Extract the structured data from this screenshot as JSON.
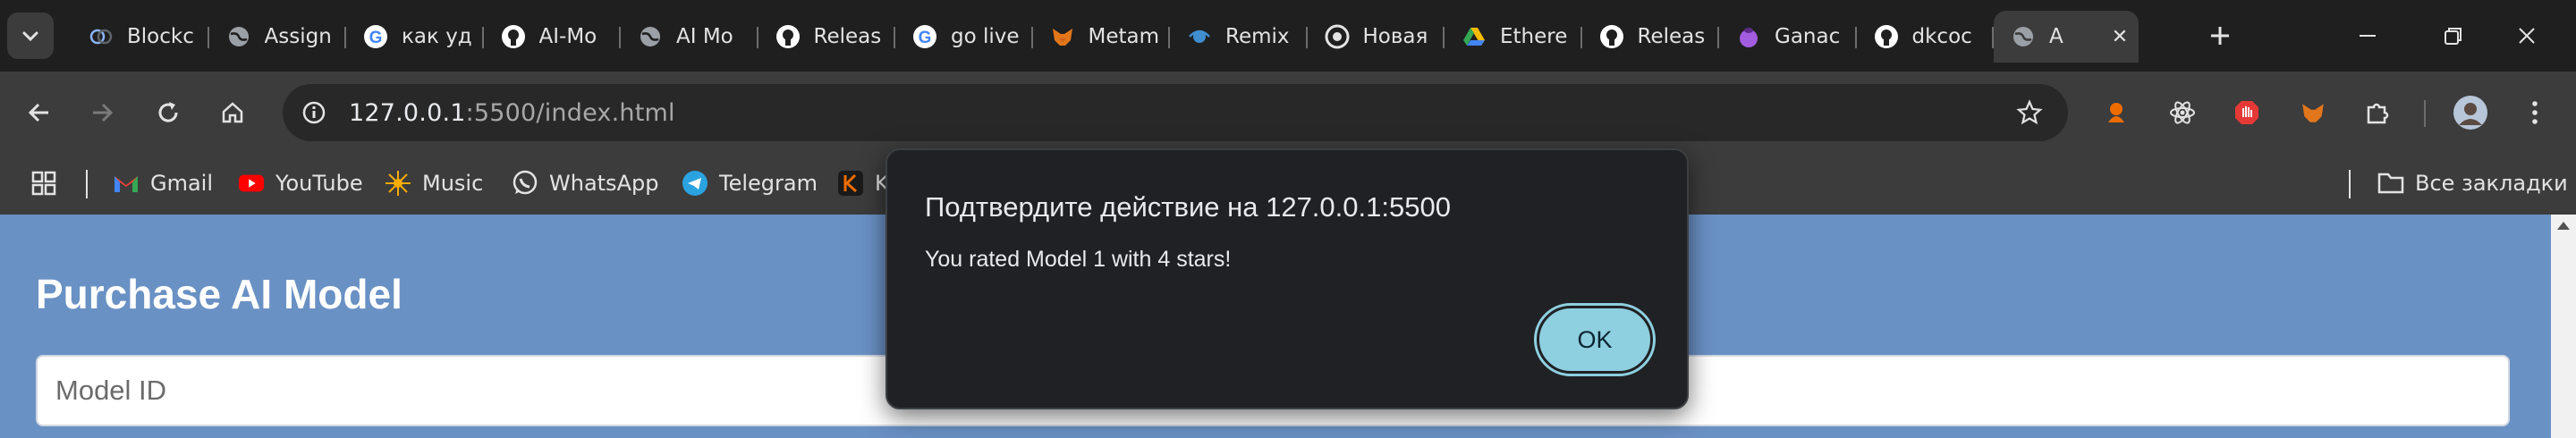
{
  "tabs": [
    {
      "title": "Blockc",
      "icon": "blockchain-icon"
    },
    {
      "title": "Assign",
      "icon": "globe-icon"
    },
    {
      "title": "как уд",
      "icon": "google-icon"
    },
    {
      "title": "AI-Mo",
      "icon": "github-icon"
    },
    {
      "title": "AI Mo",
      "icon": "globe-icon"
    },
    {
      "title": "Releas",
      "icon": "github-icon"
    },
    {
      "title": "go live",
      "icon": "google-icon"
    },
    {
      "title": "Metam",
      "icon": "metamask-icon"
    },
    {
      "title": "Remix",
      "icon": "remix-icon"
    },
    {
      "title": "Новая",
      "icon": "chrome-icon"
    },
    {
      "title": "Ethere",
      "icon": "google-drive-icon"
    },
    {
      "title": "Releas",
      "icon": "github-icon"
    },
    {
      "title": "Ganac",
      "icon": "ganache-icon"
    },
    {
      "title": "dkcoc",
      "icon": "github-icon"
    },
    {
      "title": "A",
      "icon": "globe-icon",
      "active": true
    }
  ],
  "address": {
    "host": "127.0.0.1",
    "rest": ":5500/index.html"
  },
  "bookmarks": {
    "items": [
      {
        "label": "Gmail",
        "icon": "gmail-icon"
      },
      {
        "label": "YouTube",
        "icon": "youtube-icon"
      },
      {
        "label": "Music",
        "icon": "music-icon"
      },
      {
        "label": "WhatsApp",
        "icon": "whatsapp-icon"
      },
      {
        "label": "Telegram",
        "icon": "telegram-icon"
      },
      {
        "label": "K",
        "icon": "kaggle-icon"
      }
    ],
    "all_bookmarks": "Все закладки"
  },
  "page": {
    "title": "Purchase AI Model",
    "model_id_placeholder": "Model ID"
  },
  "dialog": {
    "title": "Подтвердите действие на 127.0.0.1:5500",
    "message": "You rated Model 1 with 4 stars!",
    "ok_label": "OK"
  },
  "colors": {
    "page_background": "#6a91c4",
    "dialog_accent": "#8ecfe0",
    "chrome_dark": "#1f1f1f",
    "toolbar": "#3c3c3c"
  }
}
